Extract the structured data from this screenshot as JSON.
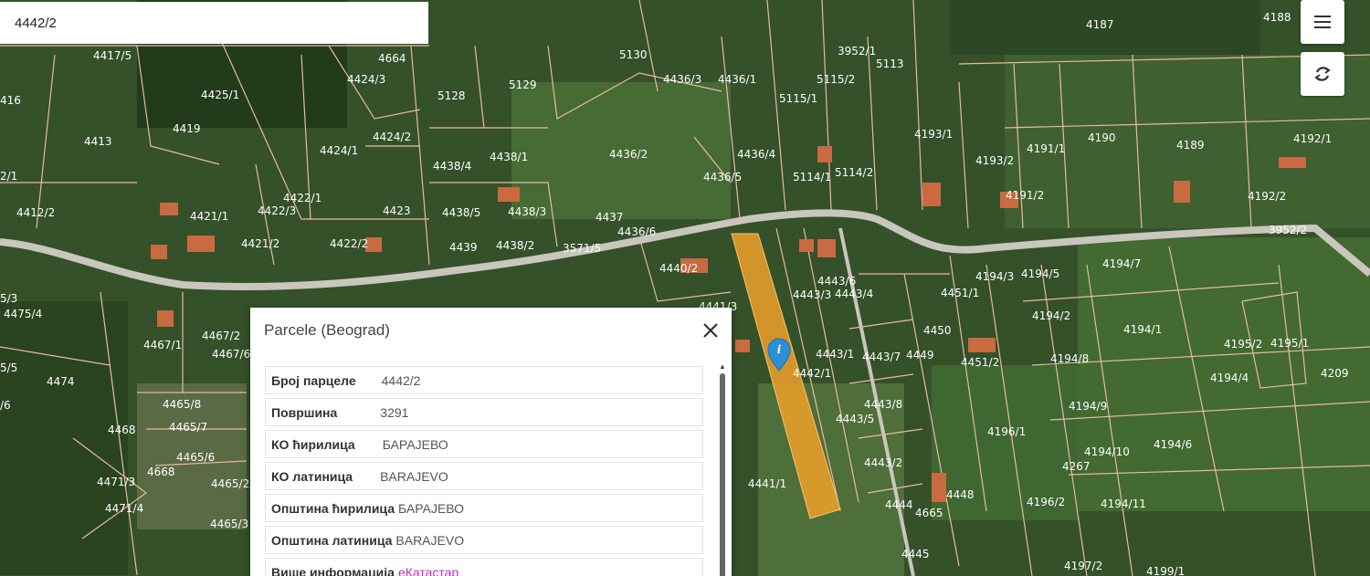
{
  "search": {
    "value": "4442/2"
  },
  "controls": {
    "menu": "menu-icon",
    "refresh": "refresh-icon"
  },
  "marker": {
    "icon": "info-marker-icon",
    "symbol": "i"
  },
  "parcel_labels": [
    "4417/5",
    "4664",
    "5130",
    "4436/3",
    "4436/1",
    "3952/1",
    "5113",
    "4187",
    "4188",
    "416",
    "4425/1",
    "4424/3",
    "5128",
    "5129",
    "5115/1",
    "5115/2",
    "4413",
    "4419",
    "4424/1",
    "4424/2",
    "4438/4",
    "4438/1",
    "4436/2",
    "4436/4",
    "5114/1",
    "5114/2",
    "4193/1",
    "4191/1",
    "4190",
    "4189",
    "4192/1",
    "2/1",
    "4412/2",
    "4422/1",
    "4422/3",
    "4423",
    "4438/5",
    "4438/3",
    "4436/5",
    "4193/2",
    "4191/2",
    "4192/2",
    "4421/1",
    "4421/2",
    "4422/2",
    "4439",
    "4438/2",
    "3571/5",
    "4437",
    "4436/6",
    "3952/2",
    "4440/2",
    "4443/6",
    "4443/3",
    "4443/4",
    "4194/3",
    "4194/5",
    "4194/7",
    "5/3",
    "4475/4",
    "4441/3",
    "4451/1",
    "4194/2",
    "4194/1",
    "4467/1",
    "4467/2",
    "4467/6",
    "4443/1",
    "4443/7",
    "4449",
    "4450",
    "4451/2",
    "4194/8",
    "4195/2",
    "4195/1",
    "5/5",
    "4474",
    "4442/1",
    "4194/4",
    "4209",
    "/6",
    "4465/8",
    "4443/8",
    "4465/7",
    "4443/5",
    "4196/1",
    "4194/9",
    "4468",
    "4465/6",
    "4194/10",
    "4194/6",
    "4471/3",
    "4668",
    "4443/2",
    "4267",
    "4441/1",
    "4465/2",
    "4471/4",
    "4444",
    "4448",
    "4196/2",
    "4194/11",
    "4665",
    "4465/3",
    "4445",
    "4197/2",
    "4199/1"
  ],
  "panel": {
    "title": "Parcele (Beograd)",
    "rows": [
      {
        "key": "Број парцеле",
        "value": "4442/2"
      },
      {
        "key": "Површина",
        "value": "3291"
      },
      {
        "key": "КО ћирилица",
        "value": "БАРАЈЕВО"
      },
      {
        "key": "КО латиница",
        "value": "BARAJEVO"
      },
      {
        "key": "Општина ћирилица",
        "value": "БАРАЈЕВО"
      },
      {
        "key": "Општина латиница",
        "value": "BARAJEVO"
      },
      {
        "key": "Више информација",
        "value": "еКатастар"
      }
    ]
  },
  "colors": {
    "parcel_line": "#e9b9a3",
    "highlight": "#f0a02a",
    "marker": "#2f8fd6"
  }
}
